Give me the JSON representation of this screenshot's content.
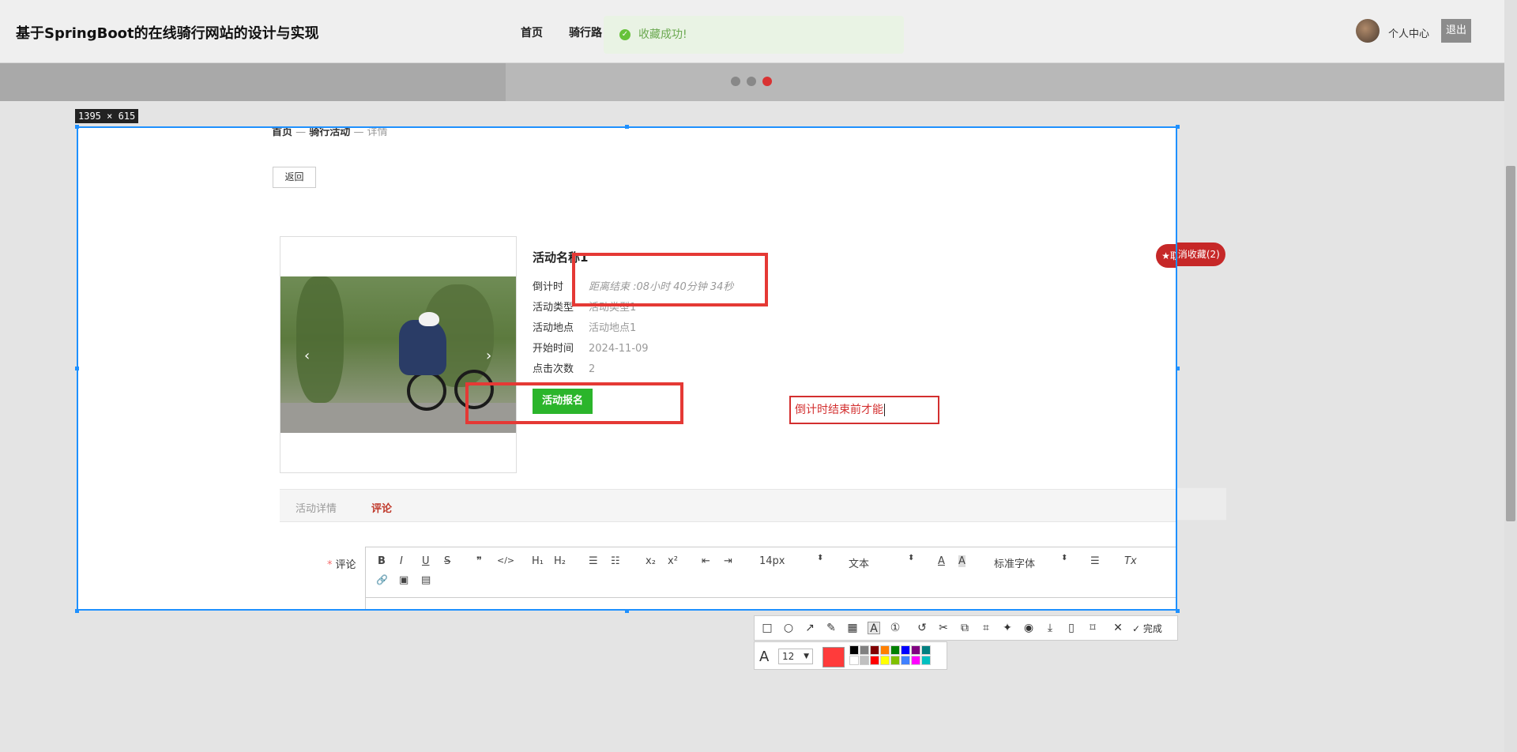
{
  "site": {
    "title": "基于SpringBoot的在线骑行网站的设计与实现",
    "nav": [
      "首页",
      "骑行路"
    ],
    "user_center": "个人中心",
    "logout": "退出"
  },
  "toast": {
    "message": "收藏成功!"
  },
  "selection": {
    "size_label": "1395 × 615"
  },
  "breadcrumb": {
    "home": "首页",
    "sep": "—",
    "section": "骑行活动",
    "current": "详情"
  },
  "back_button": "返回",
  "favorite_button": "★取消收藏(2)",
  "activity": {
    "name": "活动名称1",
    "fields": [
      {
        "key": "倒计时",
        "value": "距离结束 :08小时 40分钟 34秒"
      },
      {
        "key": "活动类型",
        "value": "活动类型1"
      },
      {
        "key": "活动地点",
        "value": "活动地点1"
      },
      {
        "key": "开始时间",
        "value": "2024-11-09"
      },
      {
        "key": "点击次数",
        "value": "2"
      }
    ],
    "signup_button": "活动报名",
    "carousel_prev": "‹",
    "carousel_next": "›"
  },
  "tabs": [
    {
      "label": "活动详情",
      "active": false
    },
    {
      "label": "评论",
      "active": true
    }
  ],
  "comment": {
    "required_mark": "*",
    "label": "评论",
    "toolbar": {
      "bold": "B",
      "italic": "I",
      "underline": "U",
      "strike": "S",
      "quote": "❞",
      "code": "</>",
      "h1": "H₁",
      "h2": "H₂",
      "ordered": "☰",
      "bullet": "☷",
      "sub": "x₂",
      "sup": "x²",
      "outdent": "⇤",
      "indent": "⇥",
      "size": "14px",
      "format": "文本",
      "color": "A",
      "bg": "A",
      "font": "标准字体",
      "align": "☰",
      "clear": "Tx",
      "link": "🔗",
      "image": "▣",
      "video": "▤"
    }
  },
  "annotation_text": "倒计时结束前才能",
  "snip_tool": {
    "done": "完成",
    "font_size": "12",
    "current_color": "#ff3b3b",
    "palette": [
      "#000000",
      "#808080",
      "#800000",
      "#ff8000",
      "#008000",
      "#0000ff",
      "#800080",
      "#008080",
      "#ffffff",
      "#c0c0c0",
      "#ff0000",
      "#ffff00",
      "#80c000",
      "#4080ff",
      "#ff00ff",
      "#00c0c0"
    ]
  }
}
